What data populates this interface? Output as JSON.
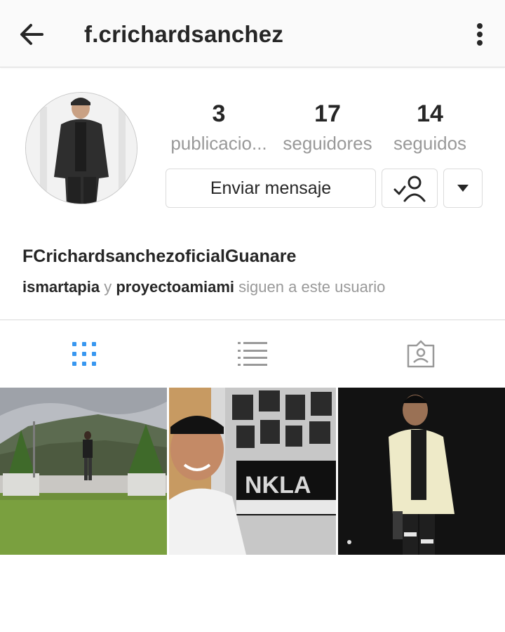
{
  "header": {
    "title": "f.crichardsanchez",
    "back_icon": "arrow-left-icon",
    "menu_icon": "more-vertical-icon"
  },
  "profile": {
    "stats": [
      {
        "value": "3",
        "label": "publicacio..."
      },
      {
        "value": "17",
        "label": "seguidores"
      },
      {
        "value": "14",
        "label": "seguidos"
      }
    ],
    "message_button": "Enviar mensaje",
    "following_icon": "user-check-icon",
    "dropdown_icon": "caret-down-icon",
    "full_name": "FCrichardsanchezoficialGuanare",
    "followed_by": {
      "user1": "ismartapia",
      "connector": "y",
      "user2": "proyectoamiami",
      "suffix": "siguen a este usuario"
    }
  },
  "tabs": [
    {
      "icon": "grid-icon",
      "active": true
    },
    {
      "icon": "list-icon",
      "active": false
    },
    {
      "icon": "tagged-photos-icon",
      "active": false
    }
  ],
  "posts": [
    {
      "scene": "man-on-lawn-mountains"
    },
    {
      "scene": "man-in-cap-smiling"
    },
    {
      "scene": "man-in-white-blazer"
    }
  ],
  "colors": {
    "accent": "#3897f0",
    "text": "#262626",
    "muted": "#999999",
    "border": "#dbdbdb"
  }
}
